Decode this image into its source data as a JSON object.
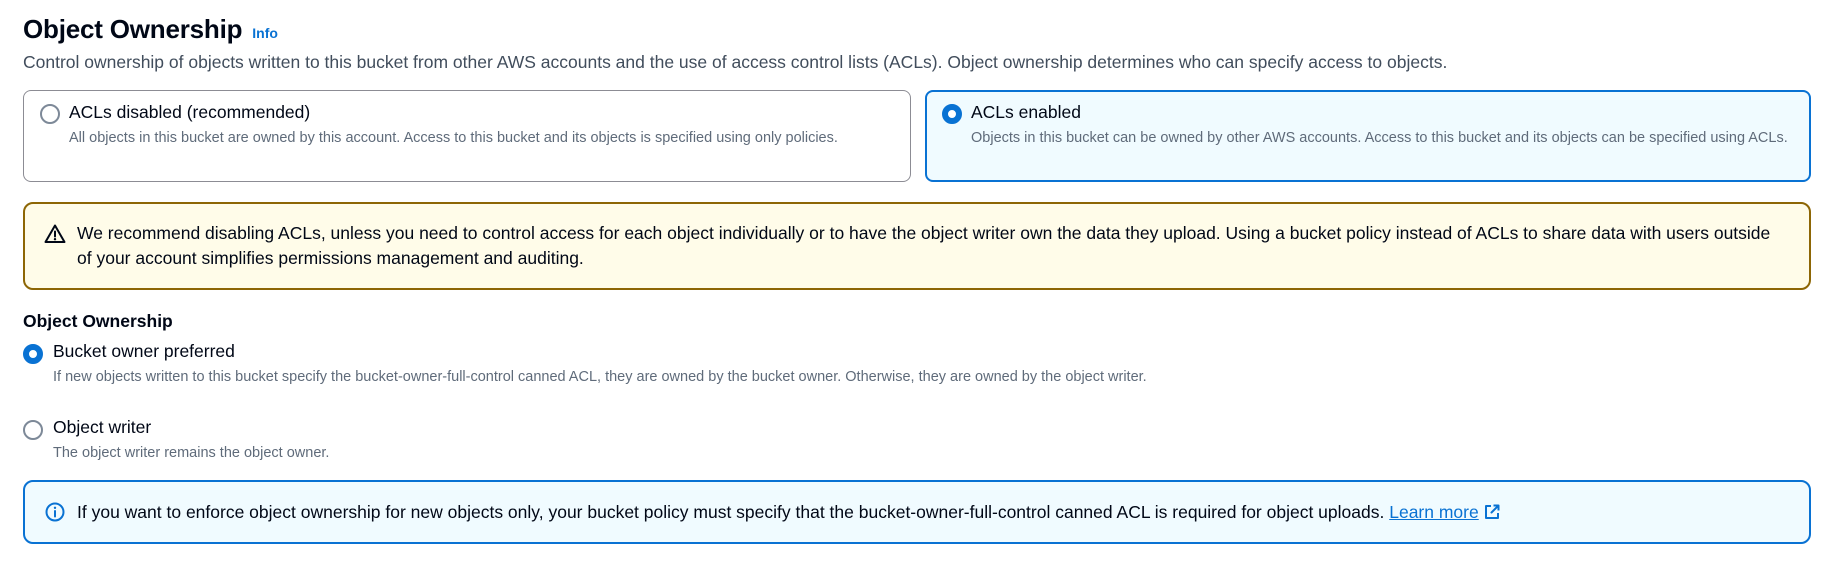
{
  "header": {
    "title": "Object Ownership",
    "info_link": "Info",
    "description": "Control ownership of objects written to this bucket from other AWS accounts and the use of access control lists (ACLs). Object ownership determines who can specify access to objects."
  },
  "acl_tiles": [
    {
      "label": "ACLs disabled (recommended)",
      "description": "All objects in this bucket are owned by this account. Access to this bucket and its objects is specified using only policies.",
      "selected": false
    },
    {
      "label": "ACLs enabled",
      "description": "Objects in this bucket can be owned by other AWS accounts. Access to this bucket and its objects can be specified using ACLs.",
      "selected": true
    }
  ],
  "warning_alert": {
    "icon": "warning-icon",
    "text": "We recommend disabling ACLs, unless you need to control access for each object individually or to have the object writer own the data they upload. Using a bucket policy instead of ACLs to share data with users outside of your account simplifies permissions management and auditing."
  },
  "ownership": {
    "label": "Object Ownership",
    "options": [
      {
        "label": "Bucket owner preferred",
        "description": "If new objects written to this bucket specify the bucket-owner-full-control canned ACL, they are owned by the bucket owner. Otherwise, they are owned by the object writer.",
        "selected": true
      },
      {
        "label": "Object writer",
        "description": "The object writer remains the object owner.",
        "selected": false
      }
    ]
  },
  "info_alert": {
    "icon": "info-icon",
    "text": "If you want to enforce object ownership for new objects only, your bucket policy must specify that the bucket-owner-full-control canned ACL is required for object uploads.",
    "link_label": "Learn more",
    "link_icon": "external-link-icon"
  },
  "colors": {
    "accent": "#0972d3",
    "warning_border": "#8d6605",
    "warning_bg": "#fffce9",
    "info_bg": "#f0fbff",
    "text_primary": "#000716",
    "text_secondary": "#5f6b7a"
  }
}
